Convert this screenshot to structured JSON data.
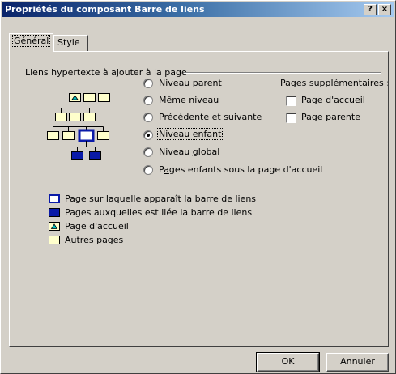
{
  "window": {
    "title": "Propriétés du composant Barre de liens",
    "help_label": "?",
    "close_label": "×"
  },
  "tabs": [
    {
      "label": "Général",
      "active": true
    },
    {
      "label": "Style",
      "active": false
    }
  ],
  "links_group": {
    "label": "Liens hypertexte à ajouter à la page"
  },
  "radio_options": [
    {
      "pre": "",
      "ul": "N",
      "post": "iveau parent",
      "selected": false
    },
    {
      "pre": "",
      "ul": "M",
      "post": "ême niveau",
      "selected": false
    },
    {
      "pre": "",
      "ul": "P",
      "post": "récédente et suivante",
      "selected": false
    },
    {
      "pre": "Niveau en",
      "ul": "f",
      "post": "ant",
      "selected": true
    },
    {
      "pre": "Niveau ",
      "ul": "g",
      "post": "lobal",
      "selected": false
    },
    {
      "pre": "P",
      "ul": "a",
      "post": "ges enfants sous la page d'accueil",
      "selected": false
    }
  ],
  "additional_pages": {
    "label": "Pages supplémentaires :",
    "items": [
      {
        "pre": "Page d'a",
        "ul": "c",
        "post": "cueil",
        "checked": false
      },
      {
        "pre": "Pag",
        "ul": "e",
        "post": " parente",
        "checked": false
      }
    ]
  },
  "legend": [
    {
      "icon": "page-with-link-bar-icon",
      "label": "Page sur laquelle apparaît la barre de liens"
    },
    {
      "icon": "linked-pages-icon",
      "label": "Pages auxquelles est liée la barre de liens"
    },
    {
      "icon": "home-page-icon",
      "label": "Page d'accueil"
    },
    {
      "icon": "other-pages-icon",
      "label": "Autres pages"
    }
  ],
  "buttons": {
    "ok_label": "OK",
    "cancel_label": "Annuler"
  },
  "colors": {
    "title_start": "#0a246a",
    "title_end": "#a6caf0",
    "face": "#d4d0c8",
    "page_yellow": "#ffffcc",
    "page_blue": "#0a1aa8",
    "home_teal": "#00c0c0"
  }
}
